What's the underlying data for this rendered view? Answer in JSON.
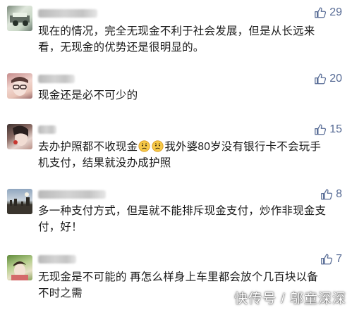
{
  "comments": [
    {
      "likes": "29",
      "text_lines": [
        "现在的情况，完全无现金不利于社会发展，但是从长远来",
        "看，无现金的优势还是很明显的。"
      ]
    },
    {
      "likes": "20",
      "text_lines": [
        "现金还是必不可少的"
      ]
    },
    {
      "likes": "15",
      "text_parts": [
        "去办护照都不收现金",
        "我外婆80岁没有银行卡不会玩手"
      ],
      "text_line2": "机支付，结果就没办成护照",
      "emoji": "worried-face-emoji"
    },
    {
      "likes": "8",
      "text_lines": [
        "多一种支付方式，但是就不能排斥现金支付，炒作非现金支",
        "付，好！"
      ]
    },
    {
      "likes": "7",
      "text_lines": [
        "无现金是不可能的 再怎么样身上车里都会放个几百块以备",
        "不时之需"
      ]
    }
  ],
  "icons": {
    "like": "thumbs-up-icon",
    "watermark_logo": "kuaichuan-logo-icon"
  },
  "watermark": {
    "text": "快传号 / 邬童深深"
  },
  "colors": {
    "like": "#576b95",
    "text": "#1a1a1a",
    "background": "#ffffff"
  }
}
